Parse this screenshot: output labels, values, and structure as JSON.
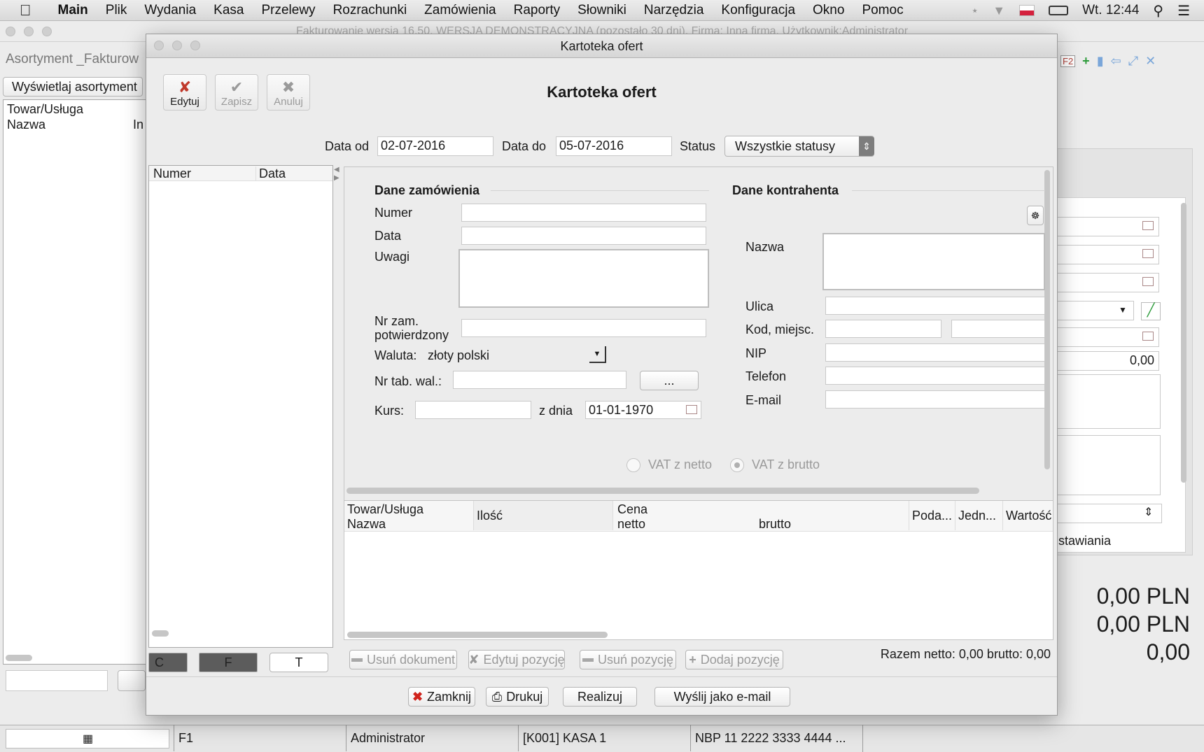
{
  "menubar": {
    "app": "Main",
    "items": [
      "Plik",
      "Wydania",
      "Kasa",
      "Przelewy",
      "Rozrachunki",
      "Zamówienia",
      "Raporty",
      "Słowniki",
      "Narzędzia",
      "Konfiguracja",
      "Okno",
      "Pomoc"
    ],
    "clock": "Wt. 12:44"
  },
  "bg": {
    "title": "Fakturowanie wersja 16.50, WERSJA DEMONSTRACYJNA (pozostało 30 dni), Firma: Inna firma,  Użytkownik:Administrator",
    "left_title": "Asortyment _Fakturow",
    "left_button": "Wyświetlaj asortyment",
    "left_col1": "Towar/Usługa",
    "left_col2": "Nazwa",
    "left_col3": "In",
    "right_value": "0,00",
    "right_text": "stawiania",
    "total1": "0,00 PLN",
    "total2": "0,00 PLN",
    "total3": "0,00",
    "status": [
      "F1",
      "Administrator",
      "[K001] KASA 1",
      "NBP  11 2222 3333 4444 ..."
    ]
  },
  "dialog": {
    "window_title": "Kartoteka ofert",
    "heading": "Kartoteka ofert",
    "toolbar": {
      "edit": "Edytuj",
      "save": "Zapisz",
      "cancel": "Anuluj"
    },
    "filter": {
      "date_from_label": "Data od",
      "date_from": "02-07-2016",
      "date_to_label": "Data do",
      "date_to": "05-07-2016",
      "status_label": "Status",
      "status_value": "Wszystkie statusy"
    },
    "list": {
      "col_number": "Numer",
      "col_date": "Data",
      "tabs": [
        "C",
        "F",
        "T"
      ]
    },
    "order": {
      "section": "Dane zamówienia",
      "number": "Numer",
      "date": "Data",
      "notes": "Uwagi",
      "confirmed_1": "Nr zam.",
      "confirmed_2": "potwierdzony",
      "currency_label": "Waluta:",
      "currency_value": "złoty polski",
      "rate_table": "Nr tab. wal.:",
      "dots": "...",
      "rate": "Kurs:",
      "rate_date_label": "z dnia",
      "rate_date": "01-01-1970"
    },
    "contractor": {
      "section": "Dane kontrahenta",
      "name": "Nazwa",
      "street": "Ulica",
      "postal": "Kod, miejsc.",
      "nip": "NIP",
      "phone": "Telefon",
      "email": "E-mail"
    },
    "vat": {
      "net": "VAT z netto",
      "gross": "VAT z brutto"
    },
    "items_table": {
      "product_1": "Towar/Usługa",
      "product_2": "Nazwa",
      "qty": "Ilość",
      "price": "Cena",
      "net": "netto",
      "gross": "brutto",
      "tax": "Poda...",
      "unit": "Jedn...",
      "value": "Wartość"
    },
    "item_buttons": {
      "delete_doc": "Usuń dokument",
      "edit_item": "Edytuj pozycję",
      "delete_item": "Usuń pozycję",
      "add_item": "Dodaj pozycję"
    },
    "totals": "Razem netto: 0,00 brutto: 0,00",
    "footer": {
      "close": "Zamknij",
      "print": "Drukuj",
      "execute": "Realizuj",
      "email": "Wyślij jako e-mail"
    }
  }
}
